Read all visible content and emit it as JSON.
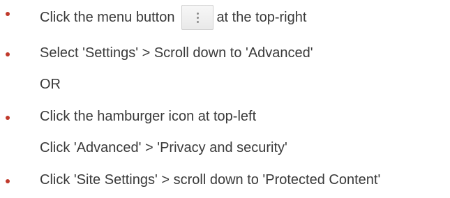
{
  "steps": {
    "step1_before": "Click the menu button",
    "step1_after": "at the top-right",
    "step2": "Select 'Settings' > Scroll down to 'Advanced'",
    "or": "OR",
    "step3": "Click the hamburger icon at top-left",
    "step3b": "Click 'Advanced' > 'Privacy and security'",
    "step4": "Click 'Site Settings' > scroll down to 'Protected Content'"
  },
  "icons": {
    "menu_button": "vertical-three-dots-icon",
    "bullet": "bullet-dot"
  },
  "colors": {
    "bullet": "#c0392b",
    "text": "#3a3a3a"
  }
}
